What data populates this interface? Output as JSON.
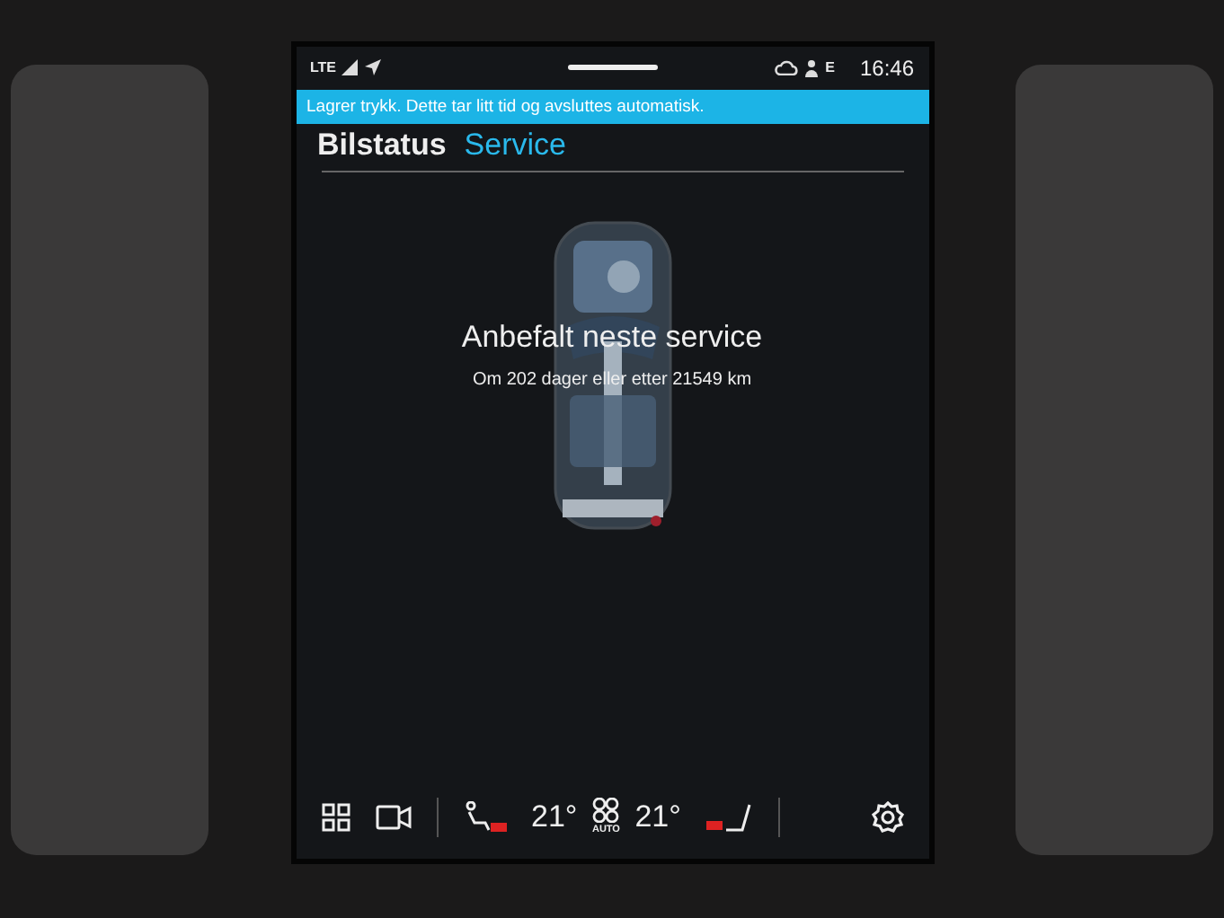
{
  "status_bar": {
    "network": "LTE",
    "profile": "E",
    "time": "16:46"
  },
  "banner": {
    "text": "Lagrer trykk. Dette tar litt tid og avsluttes automatisk."
  },
  "tabs": [
    {
      "label": "Bilstatus",
      "selected": false
    },
    {
      "label": "Service",
      "selected": true
    }
  ],
  "service": {
    "title": "Anbefalt neste service",
    "detail": "Om 202 dager eller etter 21549 km"
  },
  "climate": {
    "left_temp": "21°",
    "right_temp": "21°",
    "fan_mode": "AUTO",
    "left_seat_heating": true,
    "right_seat_heating": true
  }
}
